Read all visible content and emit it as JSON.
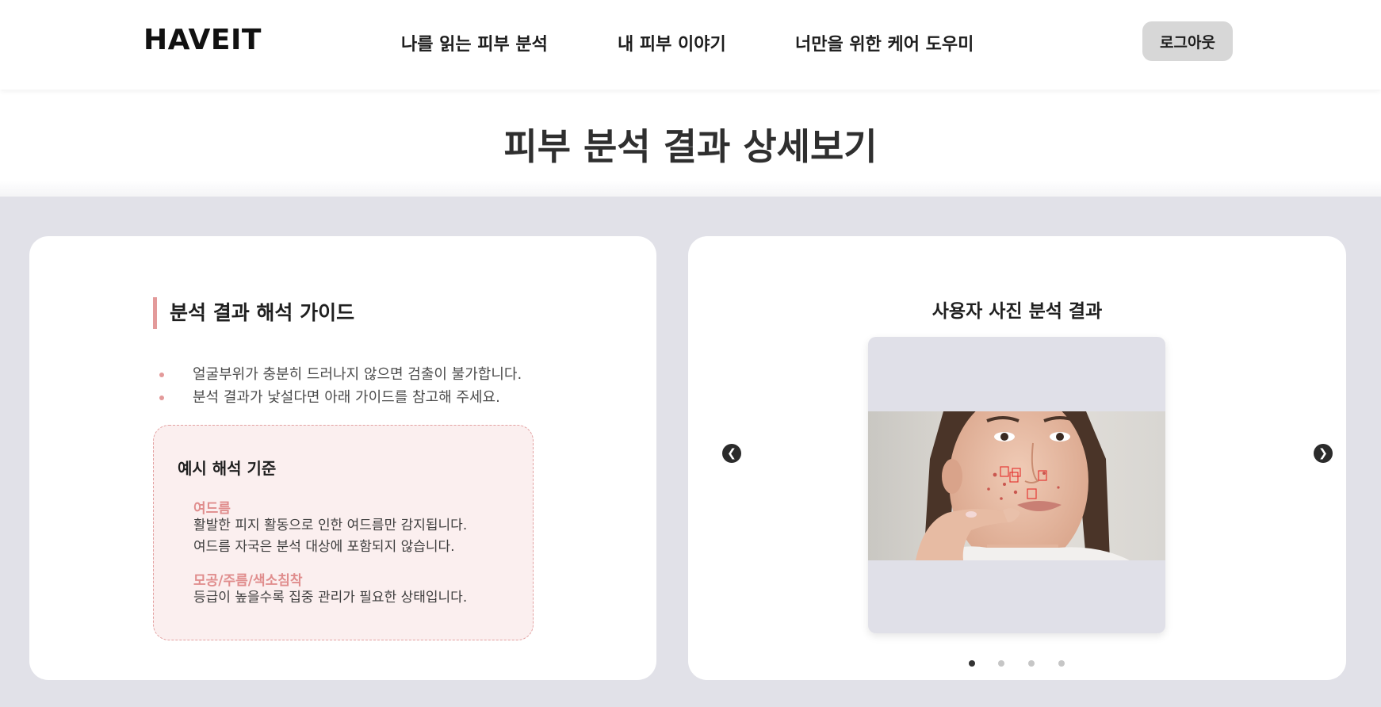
{
  "header": {
    "logo": "HAVEIT",
    "nav": [
      {
        "label": "나를 읽는 피부 분석"
      },
      {
        "label": "내 피부 이야기"
      },
      {
        "label": "너만을 위한 케어 도우미"
      }
    ],
    "logout_label": "로그아웃"
  },
  "page_title": "피부 분석 결과 상세보기",
  "guide": {
    "heading": "분석 결과 해석 가이드",
    "bullets": [
      "얼굴부위가 충분히 드러나지 않으면 검출이 불가합니다.",
      "분석 결과가 낯설다면 아래 가이드를 참고해 주세요."
    ],
    "example": {
      "title": "예시 해석 기준",
      "items": [
        {
          "term": "여드름",
          "lines": [
            "활발한 피지 활동으로 인한 여드름만 감지됩니다.",
            "여드름 자국은 분석 대상에 포함되지 않습니다."
          ]
        },
        {
          "term": "모공/주름/색소침착",
          "lines": [
            "등급이 높을수록 집중 관리가 필요한 상태입니다."
          ]
        }
      ]
    }
  },
  "result": {
    "title": "사용자 사진 분석 결과",
    "prev_icon": "chevron-left-icon",
    "next_icon": "chevron-right-icon",
    "slides_total": 4,
    "active_slide": 1
  },
  "colors": {
    "accent": "#e39a9a",
    "example_bg": "#fbefef",
    "page_bg": "#e1e1e8",
    "logout_bg": "#d7d7d7",
    "detection_box": "#e53935"
  }
}
